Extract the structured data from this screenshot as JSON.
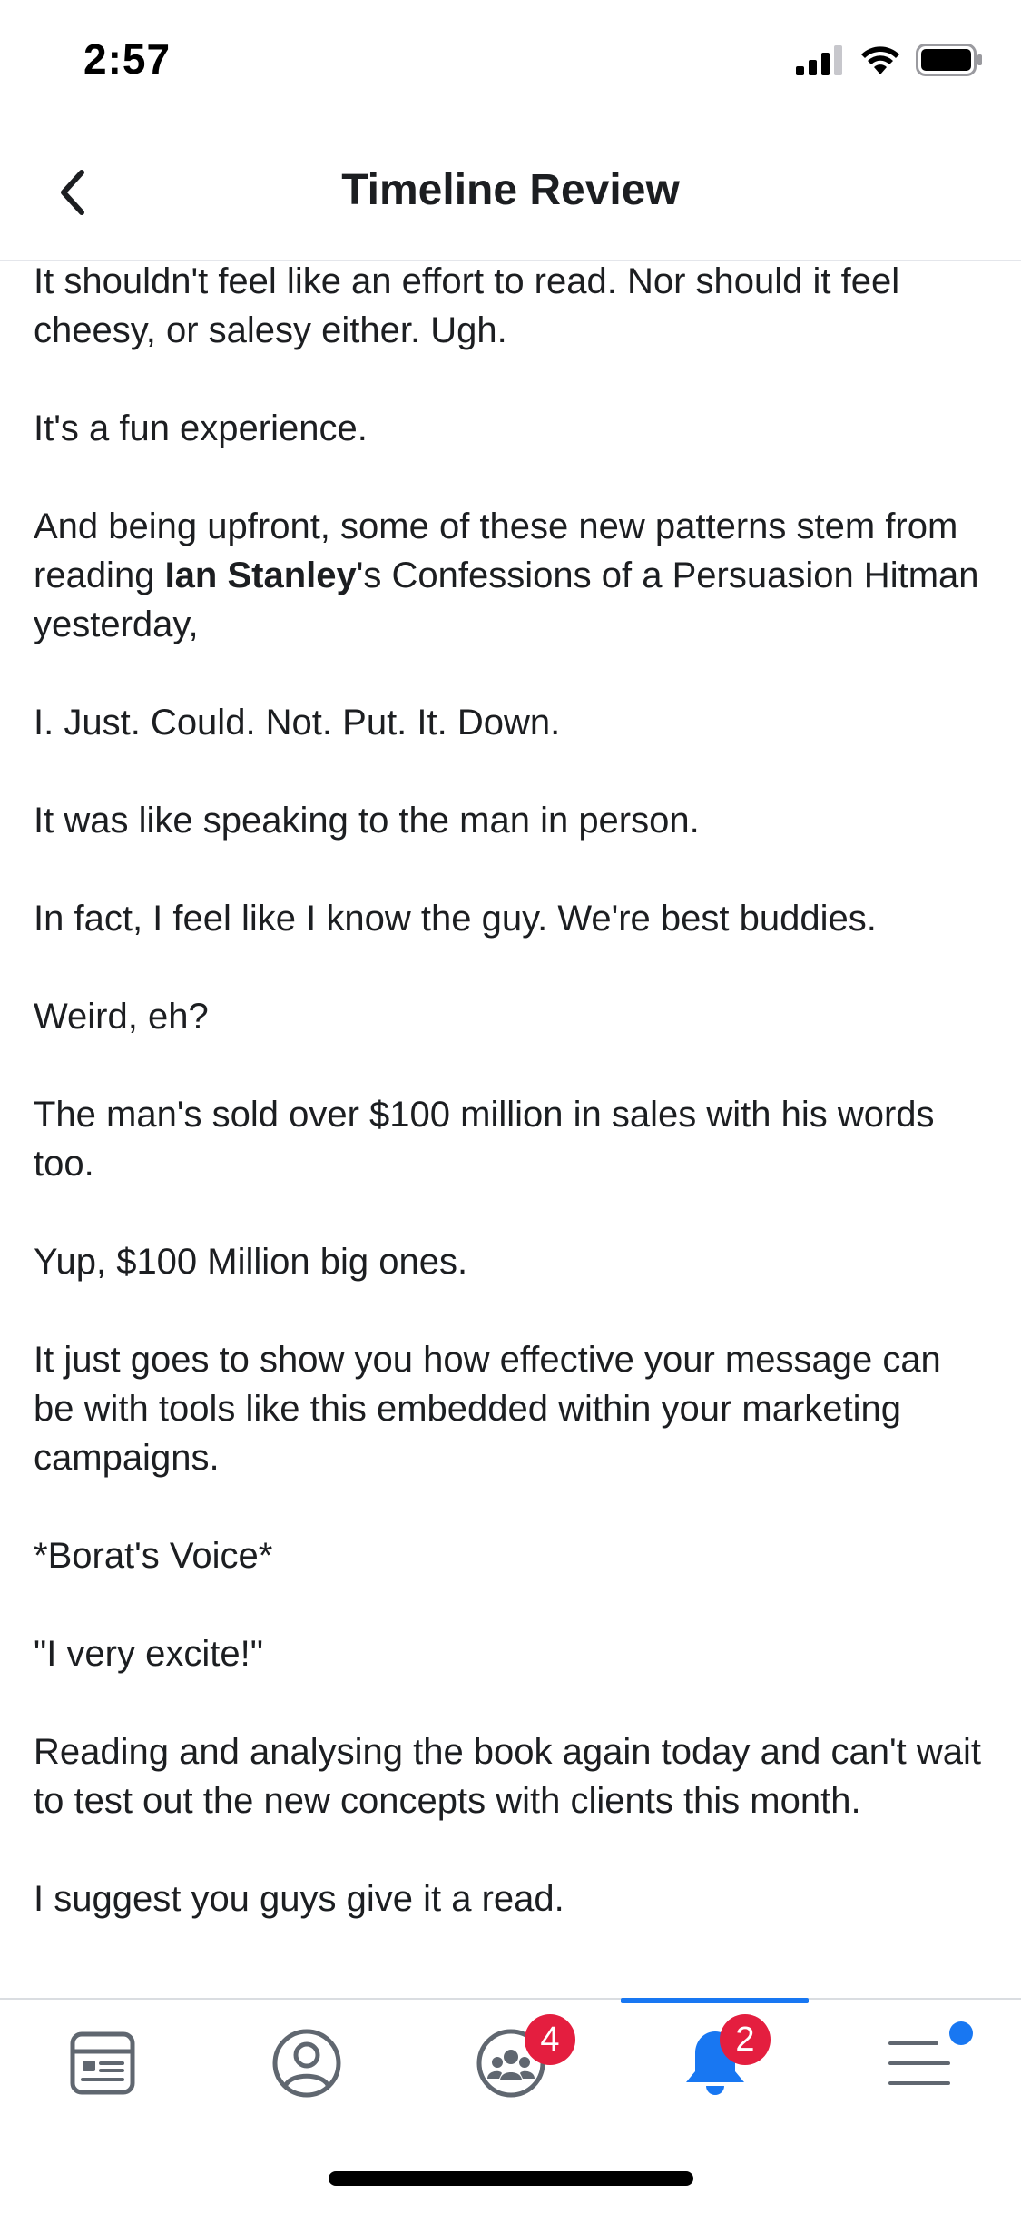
{
  "status_bar": {
    "time": "2:57",
    "icons": [
      "cellular-signal-icon",
      "wifi-icon",
      "battery-icon"
    ]
  },
  "header": {
    "title": "Timeline Review",
    "back_icon": "chevron-left-icon"
  },
  "post": {
    "paragraphs": [
      {
        "text": "It shouldn't feel like an effort to read. Nor should it feel cheesy, or salesy either. Ugh."
      },
      {
        "text": "It's a fun experience."
      },
      {
        "before": "And being upfront, some of these new patterns stem from reading ",
        "bold": "Ian Stanley",
        "after": "'s Confessions of a Persuasion Hitman yesterday,"
      },
      {
        "text": "I. Just. Could. Not. Put. It. Down."
      },
      {
        "text": "It was like speaking to the man in person."
      },
      {
        "text": "In fact, I feel like I know the guy. We're best buddies."
      },
      {
        "text": "Weird, eh?"
      },
      {
        "text": "The man's sold over $100 million in sales with his words too."
      },
      {
        "text": "Yup, $100 Million big ones."
      },
      {
        "text": "It just goes to show you how effective your message can be with tools like this embedded within your marketing campaigns."
      },
      {
        "text": "*Borat's Voice*"
      },
      {
        "text": "\"I very excite!\""
      },
      {
        "text": "Reading and analysing the book again today and can't wait to test out the new concepts with clients this month."
      },
      {
        "text": "I suggest you guys give it a read."
      }
    ]
  },
  "tab_bar": {
    "tabs": [
      {
        "name": "news-feed",
        "icon": "news-feed-icon",
        "badge": ""
      },
      {
        "name": "profile",
        "icon": "profile-icon",
        "badge": ""
      },
      {
        "name": "groups",
        "icon": "groups-icon",
        "badge": "4"
      },
      {
        "name": "notifications",
        "icon": "bell-icon",
        "badge": "2",
        "active": true
      },
      {
        "name": "menu",
        "icon": "menu-icon",
        "badge": ""
      }
    ],
    "badge_color": "#e41e3f",
    "active_color": "#1877f2",
    "inactive_color": "#606770"
  }
}
